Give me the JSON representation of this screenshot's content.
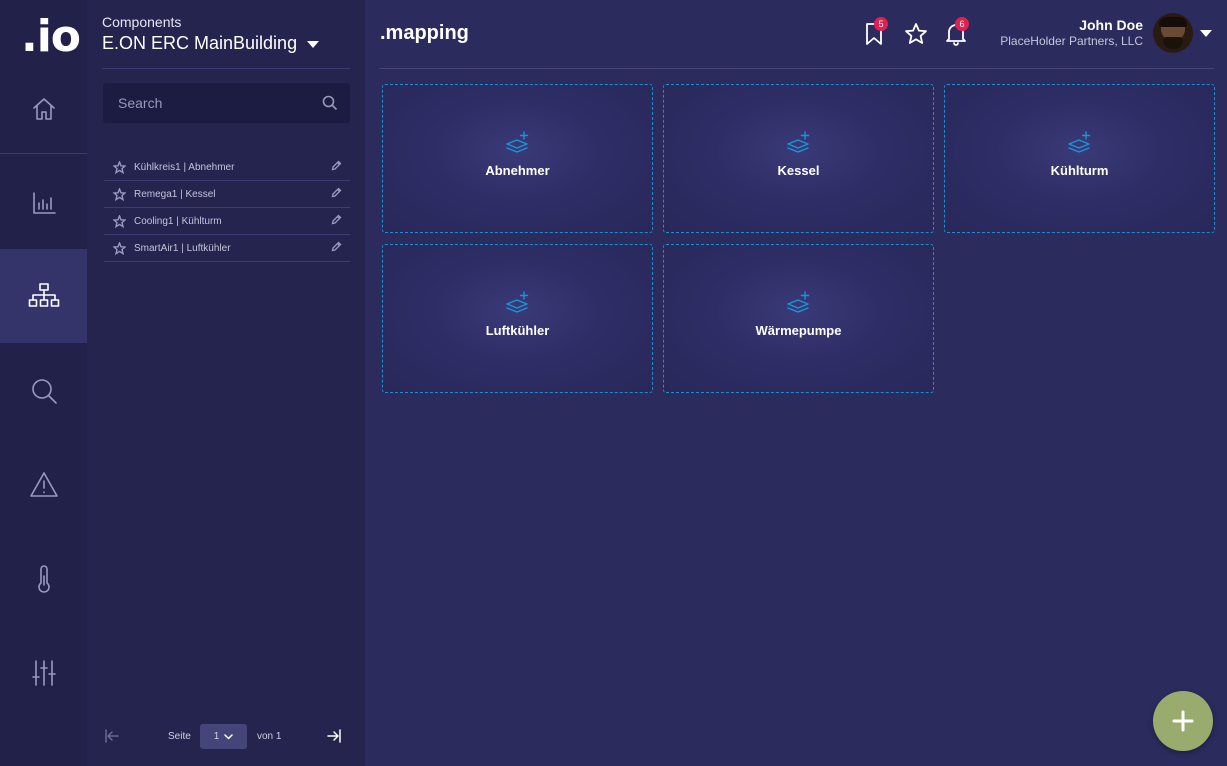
{
  "app": {
    "logo": ".io"
  },
  "nav": {
    "items": [
      {
        "icon": "home-icon"
      },
      {
        "icon": "bar-chart-icon"
      },
      {
        "icon": "hierarchy-icon",
        "active": true
      },
      {
        "icon": "search-icon"
      },
      {
        "icon": "warning-icon"
      },
      {
        "icon": "thermometer-icon"
      },
      {
        "icon": "sliders-icon"
      }
    ]
  },
  "panel": {
    "label": "Components",
    "title": "E.ON ERC MainBuilding",
    "search_placeholder": "Search",
    "items": [
      {
        "label": "Kühlkreis1 | Abnehmer"
      },
      {
        "label": "Remega1 | Kessel"
      },
      {
        "label": "Cooling1 | Kühlturm"
      },
      {
        "label": "SmartAir1 | Luftkühler"
      }
    ],
    "pager": {
      "page_label": "Seite",
      "page_value": "1",
      "of_label": "von 1"
    }
  },
  "header": {
    "title": ".mapping",
    "bookmark_badge": "5",
    "notification_badge": "6",
    "user_name": "John Doe",
    "user_org": "PlaceHolder Partners, LLC"
  },
  "cards": [
    {
      "label": "Abnehmer"
    },
    {
      "label": "Kessel"
    },
    {
      "label": "Kühlturm"
    },
    {
      "label": "Luftkühler"
    },
    {
      "label": "Wärmepumpe"
    }
  ],
  "colors": {
    "accent": "#1b95d8",
    "badge": "#e0214f",
    "fab": "#9aab6e"
  }
}
